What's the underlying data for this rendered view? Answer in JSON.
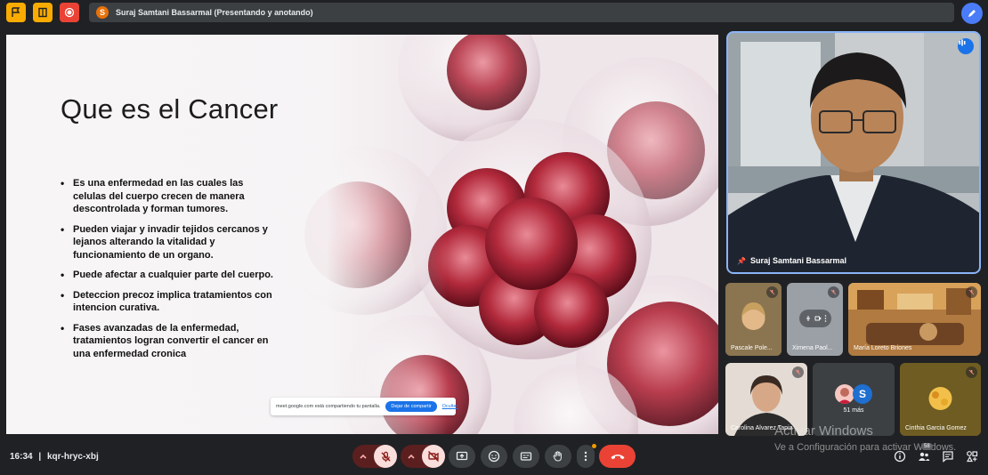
{
  "topbar": {
    "presenting_initial": "S",
    "presenting_text": "Suraj Samtani Bassarmal (Presentando y anotando)"
  },
  "slide": {
    "title": "Que es el Cancer",
    "bullets": [
      "Es una enfermedad en las cuales las celulas del cuerpo crecen de manera descontrolada y forman tumores.",
      "Pueden viajar y invadir tejidos cercanos y lejanos alterando la vitalidad y funcionamiento de un organo.",
      "Puede afectar a cualquier parte del cuerpo.",
      "Deteccion precoz implica tratamientos con intencion curativa.",
      "Fases avanzadas de la enfermedad, tratamientos logran convertir el cancer en una enfermedad cronica"
    ]
  },
  "share_bar": {
    "text": "meet.google.com está compartiendo tu pantalla.",
    "stop_label": "Dejar de compartir",
    "hide_label": "Ocultar"
  },
  "presenter": {
    "name": "Suraj Samtani Bassarmal"
  },
  "participants": [
    {
      "name": "Pascale Pole..."
    },
    {
      "name": "Ximena Paol..."
    },
    {
      "name": "María Loreto Briones"
    },
    {
      "name": "Carolina Alvarez Tapia"
    },
    {
      "name": "51 más",
      "avatar_initial": "S"
    },
    {
      "name": "Cinthia Garcia Gomez"
    }
  ],
  "bottombar": {
    "time": "16:34",
    "meeting_code": "kqr-hryc-xbj",
    "people_count": "58"
  },
  "watermark": {
    "line1": "Activar Windows",
    "line2": "Ve a Configuración para activar Windows."
  },
  "colors": {
    "accent": "#8ab4f8",
    "hangup": "#ea4335",
    "background": "#202124"
  }
}
